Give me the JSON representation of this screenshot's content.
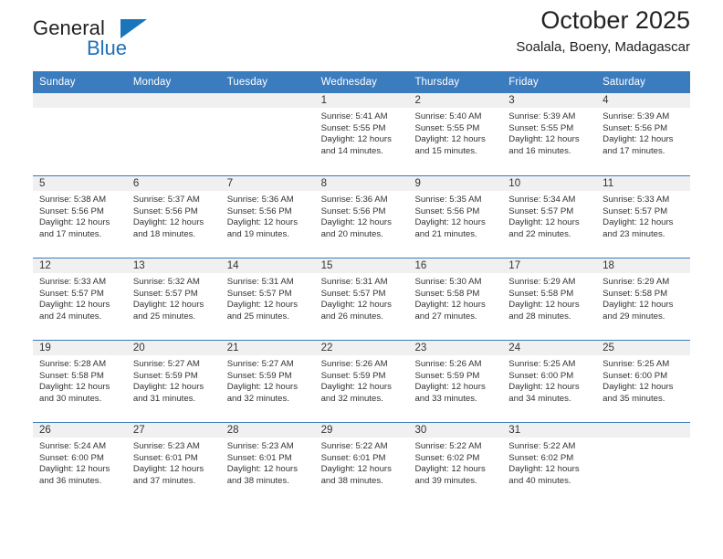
{
  "brand": {
    "word1": "General",
    "word2": "Blue",
    "triangle_color": "#1b75bb",
    "text_color": "#231f20"
  },
  "header": {
    "title": "October 2025",
    "subtitle": "Soalala, Boeny, Madagascar"
  },
  "theme": {
    "header_row_bg": "#3a7cbe",
    "day_number_bg": "#f0f0f0",
    "text_color": "#333333"
  },
  "labels": {
    "sunrise_prefix": "Sunrise:",
    "sunset_prefix": "Sunset:",
    "daylight_prefix": "Daylight:"
  },
  "weekdays": [
    "Sunday",
    "Monday",
    "Tuesday",
    "Wednesday",
    "Thursday",
    "Friday",
    "Saturday"
  ],
  "weeks": [
    [
      {
        "day": "",
        "empty": true
      },
      {
        "day": "",
        "empty": true
      },
      {
        "day": "",
        "empty": true
      },
      {
        "day": "1",
        "sunrise": "Sunrise: 5:41 AM",
        "sunset": "Sunset: 5:55 PM",
        "daylight_l1": "Daylight: 12 hours",
        "daylight_l2": "and 14 minutes."
      },
      {
        "day": "2",
        "sunrise": "Sunrise: 5:40 AM",
        "sunset": "Sunset: 5:55 PM",
        "daylight_l1": "Daylight: 12 hours",
        "daylight_l2": "and 15 minutes."
      },
      {
        "day": "3",
        "sunrise": "Sunrise: 5:39 AM",
        "sunset": "Sunset: 5:55 PM",
        "daylight_l1": "Daylight: 12 hours",
        "daylight_l2": "and 16 minutes."
      },
      {
        "day": "4",
        "sunrise": "Sunrise: 5:39 AM",
        "sunset": "Sunset: 5:56 PM",
        "daylight_l1": "Daylight: 12 hours",
        "daylight_l2": "and 17 minutes."
      }
    ],
    [
      {
        "day": "5",
        "sunrise": "Sunrise: 5:38 AM",
        "sunset": "Sunset: 5:56 PM",
        "daylight_l1": "Daylight: 12 hours",
        "daylight_l2": "and 17 minutes."
      },
      {
        "day": "6",
        "sunrise": "Sunrise: 5:37 AM",
        "sunset": "Sunset: 5:56 PM",
        "daylight_l1": "Daylight: 12 hours",
        "daylight_l2": "and 18 minutes."
      },
      {
        "day": "7",
        "sunrise": "Sunrise: 5:36 AM",
        "sunset": "Sunset: 5:56 PM",
        "daylight_l1": "Daylight: 12 hours",
        "daylight_l2": "and 19 minutes."
      },
      {
        "day": "8",
        "sunrise": "Sunrise: 5:36 AM",
        "sunset": "Sunset: 5:56 PM",
        "daylight_l1": "Daylight: 12 hours",
        "daylight_l2": "and 20 minutes."
      },
      {
        "day": "9",
        "sunrise": "Sunrise: 5:35 AM",
        "sunset": "Sunset: 5:56 PM",
        "daylight_l1": "Daylight: 12 hours",
        "daylight_l2": "and 21 minutes."
      },
      {
        "day": "10",
        "sunrise": "Sunrise: 5:34 AM",
        "sunset": "Sunset: 5:57 PM",
        "daylight_l1": "Daylight: 12 hours",
        "daylight_l2": "and 22 minutes."
      },
      {
        "day": "11",
        "sunrise": "Sunrise: 5:33 AM",
        "sunset": "Sunset: 5:57 PM",
        "daylight_l1": "Daylight: 12 hours",
        "daylight_l2": "and 23 minutes."
      }
    ],
    [
      {
        "day": "12",
        "sunrise": "Sunrise: 5:33 AM",
        "sunset": "Sunset: 5:57 PM",
        "daylight_l1": "Daylight: 12 hours",
        "daylight_l2": "and 24 minutes."
      },
      {
        "day": "13",
        "sunrise": "Sunrise: 5:32 AM",
        "sunset": "Sunset: 5:57 PM",
        "daylight_l1": "Daylight: 12 hours",
        "daylight_l2": "and 25 minutes."
      },
      {
        "day": "14",
        "sunrise": "Sunrise: 5:31 AM",
        "sunset": "Sunset: 5:57 PM",
        "daylight_l1": "Daylight: 12 hours",
        "daylight_l2": "and 25 minutes."
      },
      {
        "day": "15",
        "sunrise": "Sunrise: 5:31 AM",
        "sunset": "Sunset: 5:57 PM",
        "daylight_l1": "Daylight: 12 hours",
        "daylight_l2": "and 26 minutes."
      },
      {
        "day": "16",
        "sunrise": "Sunrise: 5:30 AM",
        "sunset": "Sunset: 5:58 PM",
        "daylight_l1": "Daylight: 12 hours",
        "daylight_l2": "and 27 minutes."
      },
      {
        "day": "17",
        "sunrise": "Sunrise: 5:29 AM",
        "sunset": "Sunset: 5:58 PM",
        "daylight_l1": "Daylight: 12 hours",
        "daylight_l2": "and 28 minutes."
      },
      {
        "day": "18",
        "sunrise": "Sunrise: 5:29 AM",
        "sunset": "Sunset: 5:58 PM",
        "daylight_l1": "Daylight: 12 hours",
        "daylight_l2": "and 29 minutes."
      }
    ],
    [
      {
        "day": "19",
        "sunrise": "Sunrise: 5:28 AM",
        "sunset": "Sunset: 5:58 PM",
        "daylight_l1": "Daylight: 12 hours",
        "daylight_l2": "and 30 minutes."
      },
      {
        "day": "20",
        "sunrise": "Sunrise: 5:27 AM",
        "sunset": "Sunset: 5:59 PM",
        "daylight_l1": "Daylight: 12 hours",
        "daylight_l2": "and 31 minutes."
      },
      {
        "day": "21",
        "sunrise": "Sunrise: 5:27 AM",
        "sunset": "Sunset: 5:59 PM",
        "daylight_l1": "Daylight: 12 hours",
        "daylight_l2": "and 32 minutes."
      },
      {
        "day": "22",
        "sunrise": "Sunrise: 5:26 AM",
        "sunset": "Sunset: 5:59 PM",
        "daylight_l1": "Daylight: 12 hours",
        "daylight_l2": "and 32 minutes."
      },
      {
        "day": "23",
        "sunrise": "Sunrise: 5:26 AM",
        "sunset": "Sunset: 5:59 PM",
        "daylight_l1": "Daylight: 12 hours",
        "daylight_l2": "and 33 minutes."
      },
      {
        "day": "24",
        "sunrise": "Sunrise: 5:25 AM",
        "sunset": "Sunset: 6:00 PM",
        "daylight_l1": "Daylight: 12 hours",
        "daylight_l2": "and 34 minutes."
      },
      {
        "day": "25",
        "sunrise": "Sunrise: 5:25 AM",
        "sunset": "Sunset: 6:00 PM",
        "daylight_l1": "Daylight: 12 hours",
        "daylight_l2": "and 35 minutes."
      }
    ],
    [
      {
        "day": "26",
        "sunrise": "Sunrise: 5:24 AM",
        "sunset": "Sunset: 6:00 PM",
        "daylight_l1": "Daylight: 12 hours",
        "daylight_l2": "and 36 minutes."
      },
      {
        "day": "27",
        "sunrise": "Sunrise: 5:23 AM",
        "sunset": "Sunset: 6:01 PM",
        "daylight_l1": "Daylight: 12 hours",
        "daylight_l2": "and 37 minutes."
      },
      {
        "day": "28",
        "sunrise": "Sunrise: 5:23 AM",
        "sunset": "Sunset: 6:01 PM",
        "daylight_l1": "Daylight: 12 hours",
        "daylight_l2": "and 38 minutes."
      },
      {
        "day": "29",
        "sunrise": "Sunrise: 5:22 AM",
        "sunset": "Sunset: 6:01 PM",
        "daylight_l1": "Daylight: 12 hours",
        "daylight_l2": "and 38 minutes."
      },
      {
        "day": "30",
        "sunrise": "Sunrise: 5:22 AM",
        "sunset": "Sunset: 6:02 PM",
        "daylight_l1": "Daylight: 12 hours",
        "daylight_l2": "and 39 minutes."
      },
      {
        "day": "31",
        "sunrise": "Sunrise: 5:22 AM",
        "sunset": "Sunset: 6:02 PM",
        "daylight_l1": "Daylight: 12 hours",
        "daylight_l2": "and 40 minutes."
      },
      {
        "day": "",
        "empty": true
      }
    ]
  ]
}
